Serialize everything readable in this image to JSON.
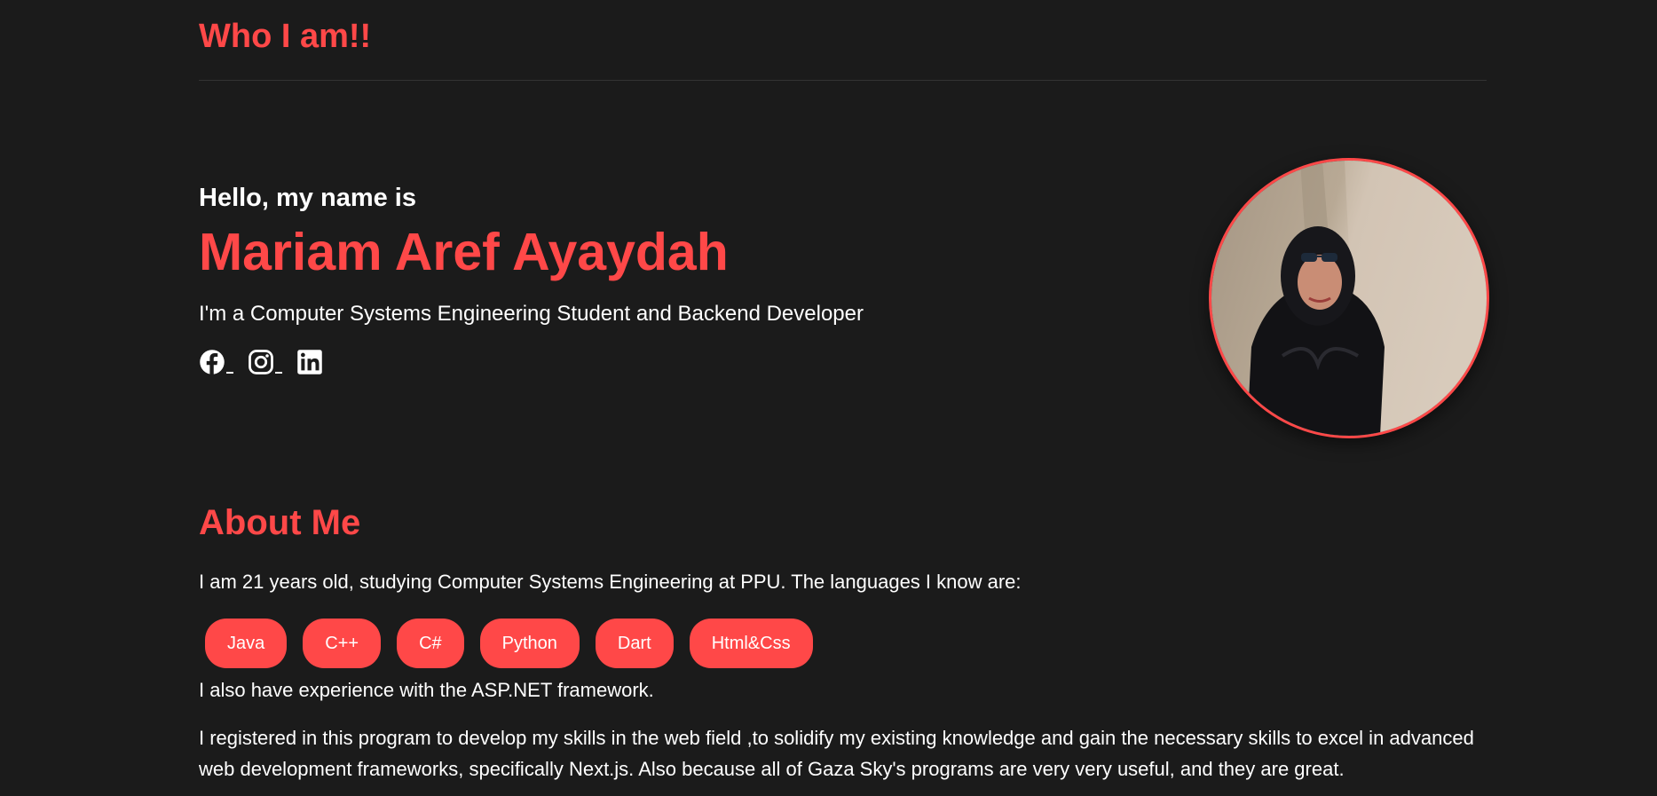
{
  "header": {
    "brand": "Who I am!!"
  },
  "hero": {
    "greeting": "Hello, my name is",
    "name": "Mariam Aref Ayaydah",
    "tagline": "I'm a Computer Systems Engineering Student and Backend Developer",
    "socials": [
      {
        "icon": "facebook-icon"
      },
      {
        "icon": "instagram-icon"
      },
      {
        "icon": "linkedin-icon"
      }
    ]
  },
  "colors": {
    "background": "#1b1b1b",
    "accent": "#ff4848",
    "text": "#ffffff"
  },
  "about": {
    "title": "About Me",
    "intro": "I am 21 years old, studying Computer Systems Engineering at PPU. The languages I know are:",
    "languages": [
      "Java",
      "C++",
      "C#",
      "Python",
      "Dart",
      "Html&Css"
    ],
    "framework": "I also have experience with the ASP.NET framework.",
    "program": "I registered in this program to develop my skills in the web field ,to solidify my existing knowledge and gain the necessary skills to excel in advanced web development frameworks, specifically Next.js. Also because all of Gaza Sky's programs are very very useful, and they are great."
  }
}
